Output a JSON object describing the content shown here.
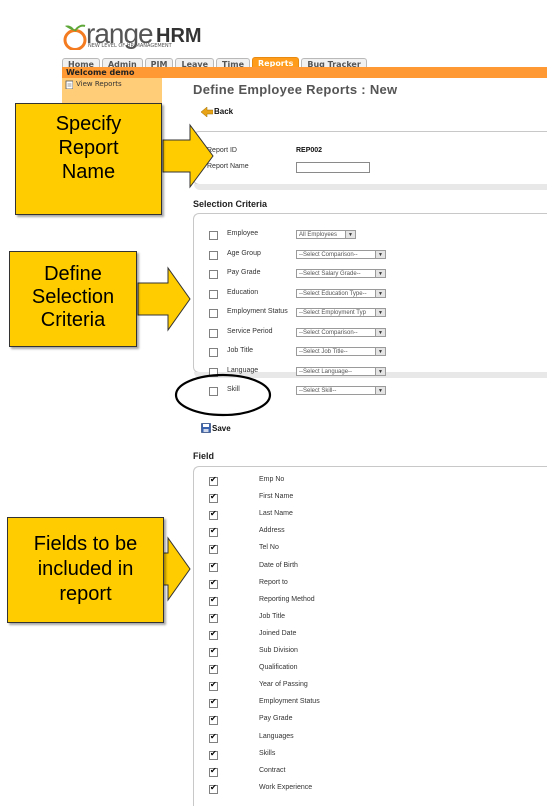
{
  "app": {
    "logo_text": "range",
    "logo_hrm": "HRM",
    "tagline": "NEW LEVEL OF HR MANAGEMENT",
    "tabs": [
      "Home",
      "Admin",
      "PIM",
      "Leave",
      "Time",
      "Reports",
      "Bug Tracker"
    ],
    "active_tab": "Reports",
    "welcome": "Welcome demo",
    "sidebar_item": "View Reports"
  },
  "page": {
    "title": "Define Employee Reports : New",
    "back_label": "Back",
    "save_label": "Save"
  },
  "report_info": {
    "id_label": "Report ID",
    "id_value": "REP002",
    "name_label": "Report Name",
    "name_value": ""
  },
  "selection_criteria": {
    "title": "Selection Criteria",
    "rows": [
      {
        "label": "Employee",
        "select": "All Employees"
      },
      {
        "label": "Age Group",
        "select": "--Select Comparison--"
      },
      {
        "label": "Pay Grade",
        "select": "--Select Salary Grade--"
      },
      {
        "label": "Education",
        "select": "--Select Education Type--"
      },
      {
        "label": "Employment Status",
        "select": "--Select Employment Typ"
      },
      {
        "label": "Service Period",
        "select": "--Select Comparison--"
      },
      {
        "label": "Job Title",
        "select": "--Select Job Title--"
      },
      {
        "label": "Language",
        "select": "--Select Language--"
      },
      {
        "label": "Skill",
        "select": "--Select Skill--"
      }
    ]
  },
  "fields": {
    "title": "Field",
    "items": [
      "Emp No",
      "First Name",
      "Last Name",
      "Address",
      "Tel No",
      "Date of Birth",
      "Report to",
      "Reporting Method",
      "Job Title",
      "Joined Date",
      "Sub Division",
      "Qualification",
      "Year of Passing",
      "Employment Status",
      "Pay Grade",
      "Languages",
      "Skills",
      "Contract",
      "Work Experience"
    ]
  },
  "callouts": {
    "specify": "Specify Report Name",
    "specify_lines": [
      "Specify",
      "Report",
      "Name"
    ],
    "define_lines": [
      "Define",
      "Selection",
      "Criteria"
    ],
    "fields_lines": [
      "Fields to be",
      "included in",
      "report"
    ]
  },
  "colors": {
    "accent": "#ff9c1a",
    "callout": "#ffcc00",
    "logo_orange": "#f47b20",
    "logo_green": "#5ea83a"
  }
}
